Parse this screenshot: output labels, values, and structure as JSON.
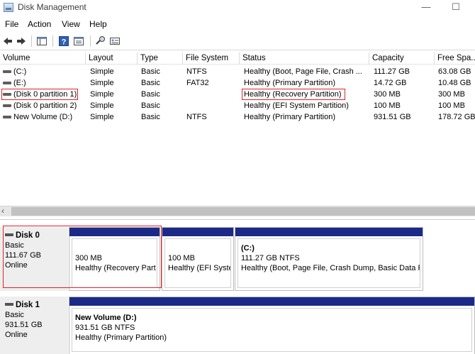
{
  "window": {
    "title": "Disk Management",
    "minimize_glyph": "—",
    "maximize_glyph": "☐"
  },
  "menu": [
    "File",
    "Action",
    "View",
    "Help"
  ],
  "toolbar": {
    "icons": [
      "back-icon",
      "forward-icon",
      "console-tree-icon",
      "help-icon",
      "properties-icon",
      "connect-icon",
      "properties-sheet-icon"
    ]
  },
  "volume_list": {
    "columns": [
      "Volume",
      "Layout",
      "Type",
      "File System",
      "Status",
      "Capacity",
      "Free Spa..."
    ],
    "rows": [
      {
        "volume": "(C:)",
        "layout": "Simple",
        "type": "Basic",
        "fs": "NTFS",
        "status": "Healthy (Boot, Page File, Crash ...",
        "capacity": "111.27 GB",
        "free": "63.08 GB"
      },
      {
        "volume": "(E:)",
        "layout": "Simple",
        "type": "Basic",
        "fs": "FAT32",
        "status": "Healthy (Primary Partition)",
        "capacity": "14.72 GB",
        "free": "10.48 GB"
      },
      {
        "volume": "(Disk 0 partition 1)",
        "layout": "Simple",
        "type": "Basic",
        "fs": "",
        "status": "Healthy (Recovery Partition)",
        "capacity": "300 MB",
        "free": "300 MB"
      },
      {
        "volume": "(Disk 0 partition 2)",
        "layout": "Simple",
        "type": "Basic",
        "fs": "",
        "status": "Healthy (EFI System Partition)",
        "capacity": "100 MB",
        "free": "100 MB"
      },
      {
        "volume": "New Volume (D:)",
        "layout": "Simple",
        "type": "Basic",
        "fs": "NTFS",
        "status": "Healthy (Primary Partition)",
        "capacity": "931.51 GB",
        "free": "178.72 GB"
      }
    ]
  },
  "scrollbar": {
    "left_arrow": "‹"
  },
  "disks": [
    {
      "name": "Disk 0",
      "type": "Basic",
      "size": "111.67 GB",
      "state": "Online",
      "partitions": [
        {
          "name": "",
          "size": "300 MB",
          "status": "Healthy (Recovery Part"
        },
        {
          "name": "",
          "size": "100 MB",
          "status": "Healthy (EFI Syste"
        },
        {
          "name": "(C:)",
          "size": "111.27 GB NTFS",
          "status": "Healthy (Boot, Page File, Crash Dump, Basic Data P"
        }
      ]
    },
    {
      "name": "Disk 1",
      "type": "Basic",
      "size": "931.51 GB",
      "state": "Online",
      "partitions": [
        {
          "name": "New Volume  (D:)",
          "size": "931.51 GB NTFS",
          "status": "Healthy (Primary Partition)"
        }
      ]
    }
  ],
  "colors": {
    "partition_bar": "#1b2a87",
    "highlight": "#e0202a"
  }
}
